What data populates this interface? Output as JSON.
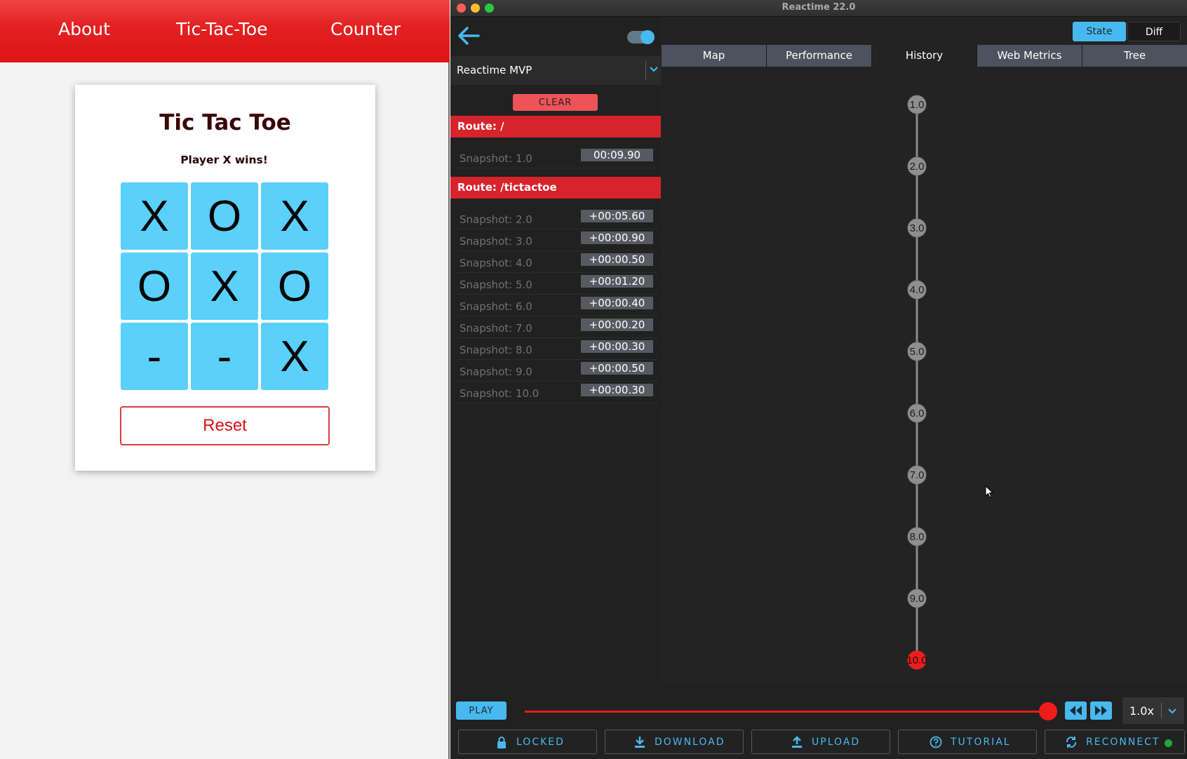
{
  "nav": {
    "about": "About",
    "tictactoe": "Tic-Tac-Toe",
    "counter": "Counter"
  },
  "game": {
    "title": "Tic Tac Toe",
    "status": "Player X wins!",
    "board": [
      "X",
      "O",
      "X",
      "O",
      "X",
      "O",
      "-",
      "-",
      "X"
    ],
    "reset_label": "Reset"
  },
  "window": {
    "title": "Reactime 22.0"
  },
  "sidebar": {
    "app_select": "Reactime MVP",
    "clear_label": "CLEAR",
    "routes": [
      {
        "label": "Route: /",
        "snapshots": [
          {
            "label": "Snapshot: 1.0",
            "time": "00:09.90"
          }
        ]
      },
      {
        "label": "Route: /tictactoe",
        "snapshots": [
          {
            "label": "Snapshot: 2.0",
            "time": "+00:05.60"
          },
          {
            "label": "Snapshot: 3.0",
            "time": "+00:00.90"
          },
          {
            "label": "Snapshot: 4.0",
            "time": "+00:00.50"
          },
          {
            "label": "Snapshot: 5.0",
            "time": "+00:01.20"
          },
          {
            "label": "Snapshot: 6.0",
            "time": "+00:00.40"
          },
          {
            "label": "Snapshot: 7.0",
            "time": "+00:00.20"
          },
          {
            "label": "Snapshot: 8.0",
            "time": "+00:00.30"
          },
          {
            "label": "Snapshot: 9.0",
            "time": "+00:00.50"
          },
          {
            "label": "Snapshot: 10.0",
            "time": "+00:00.30"
          }
        ]
      }
    ]
  },
  "main": {
    "view_toggle": {
      "state": "State",
      "diff": "Diff"
    },
    "tabs": [
      "Map",
      "Performance",
      "History",
      "Web Metrics",
      "Tree"
    ],
    "active_tab": "History",
    "history_nodes": [
      "1.0",
      "2.0",
      "3.0",
      "4.0",
      "5.0",
      "6.0",
      "7.0",
      "8.0",
      "9.0",
      "10.0"
    ],
    "current_node": "10.0"
  },
  "bottom": {
    "play_label": "PLAY",
    "slider_progress": 1.0,
    "speed": "1.0x",
    "actions": {
      "locked": "LOCKED",
      "download": "DOWNLOAD",
      "upload": "UPLOAD",
      "tutorial": "TUTORIAL",
      "reconnect": "RECONNECT"
    }
  },
  "colors": {
    "accent_blue": "#48b9ef",
    "accent_red": "#d7232b",
    "cell_blue": "#5bd0fb",
    "connected_green": "#1fa83a"
  }
}
